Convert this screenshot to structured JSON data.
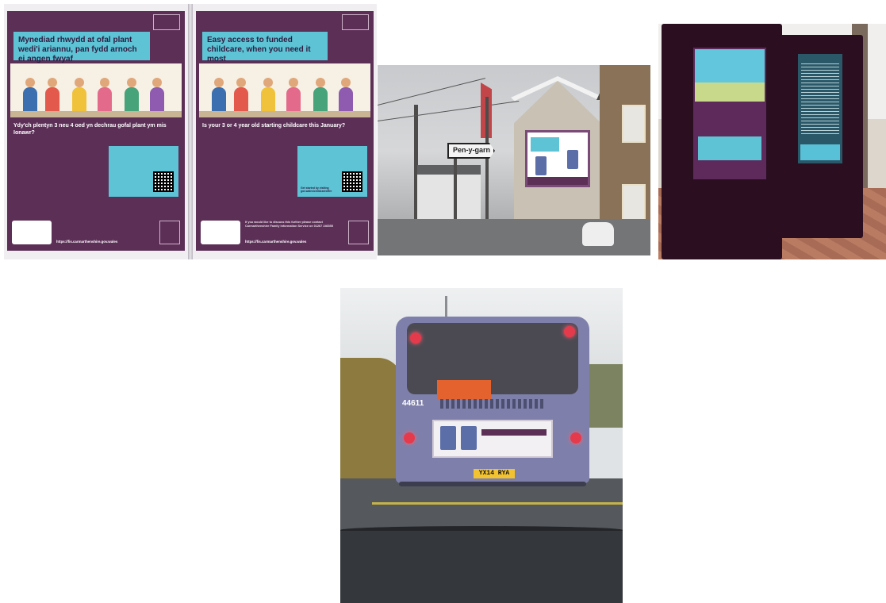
{
  "newspaper": {
    "welsh": {
      "headline": "Mynediad rhwydd at ofal plant wedi'i ariannu, pan fydd arnoch ei angen fwyaf",
      "question": "Ydy'ch plentyn 3 neu 4 oed yn dechrau gofal plant ym mis Ionawr?",
      "url": "https://fis.carmarthenshire.gov.wales"
    },
    "english": {
      "headline": "Easy access to funded childcare, when you need it most",
      "question": "Is your 3 or 4 year old starting childcare this January?",
      "footer": "If you would like to discuss this further please contact Carmarthenshire Family Information Service on 01267 246555",
      "url": "https://fis.carmarthenshire.gov.wales",
      "side_cta": "Get started by visiting gov.wales/childcareoffer"
    }
  },
  "street": {
    "sign_text": "Pen-y-garn"
  },
  "bus": {
    "fleet_number": "44611",
    "plate": "YX14 RYA"
  },
  "colors": {
    "purple": "#5c2f57",
    "teal": "#5dc3d5"
  }
}
